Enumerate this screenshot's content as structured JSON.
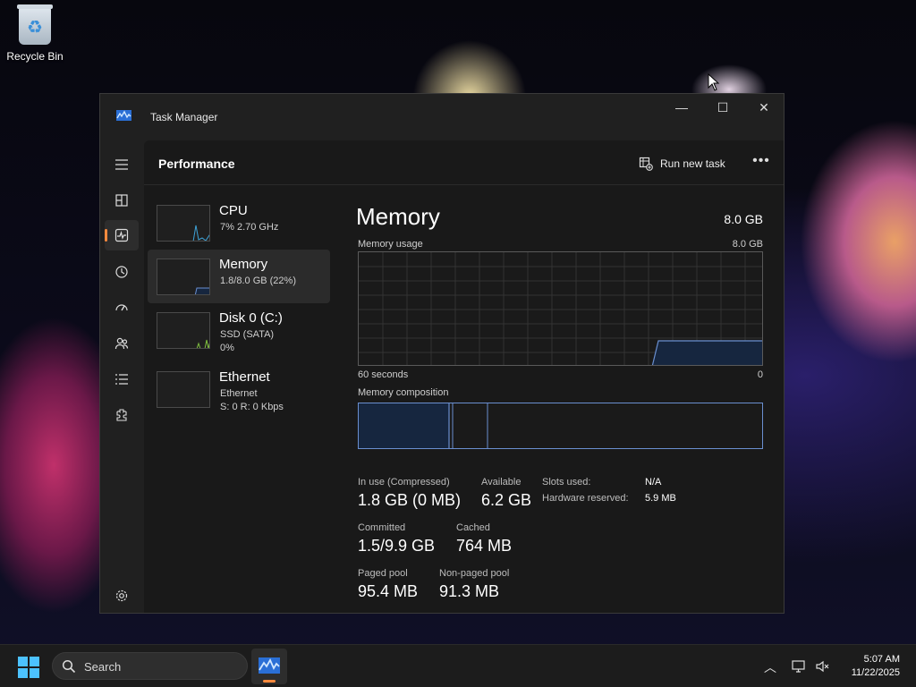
{
  "desktop": {
    "recycle_bin_label": "Recycle Bin"
  },
  "window": {
    "title": "Task Manager",
    "minimize": "—",
    "maximize": "☐",
    "close": "✕"
  },
  "nav": {
    "icons": [
      "hamburger-menu-icon",
      "processes-icon",
      "performance-icon",
      "app-history-icon",
      "startup-apps-icon",
      "users-icon",
      "details-icon",
      "services-icon",
      "settings-icon"
    ],
    "active": "performance-icon"
  },
  "header": {
    "page_title": "Performance",
    "run_new_task": "Run new task",
    "more": "•••"
  },
  "perf_items": [
    {
      "name": "CPU",
      "sub1": "7% 2.70 GHz",
      "sub2": "",
      "sub3": ""
    },
    {
      "name": "Memory",
      "sub1": "1.8/8.0 GB (22%)",
      "sub2": "",
      "sub3": ""
    },
    {
      "name": "Disk 0 (C:)",
      "sub1": "SSD (SATA)",
      "sub2": "0%",
      "sub3": ""
    },
    {
      "name": "Ethernet",
      "sub1": "Ethernet",
      "sub2": "S: 0 R: 0 Kbps",
      "sub3": ""
    }
  ],
  "detail": {
    "title": "Memory",
    "capacity": "8.0 GB",
    "usage_label": "Memory usage",
    "usage_max": "8.0 GB",
    "time_label": "60 seconds",
    "zero_label": "0",
    "composition_label": "Memory composition",
    "stats": {
      "in_use_label": "In use (Compressed)",
      "in_use_value": "1.8 GB (0 MB)",
      "available_label": "Available",
      "available_value": "6.2 GB",
      "committed_label": "Committed",
      "committed_value": "1.5/9.9 GB",
      "cached_label": "Cached",
      "cached_value": "764 MB",
      "paged_label": "Paged pool",
      "paged_value": "95.4 MB",
      "nonpaged_label": "Non-paged pool",
      "nonpaged_value": "91.3 MB",
      "slots_label": "Slots used:",
      "slots_value": "N/A",
      "hw_label": "Hardware reserved:",
      "hw_value": "5.9 MB"
    }
  },
  "colors": {
    "accent_orange": "#ff8a3d",
    "memory_blue": "#6a8fd0",
    "cpu_line": "#3ea3d8",
    "disk_line": "#7fbf3f"
  },
  "taskbar": {
    "search_placeholder": "Search",
    "time": "5:07 AM",
    "date": "11/22/2025"
  }
}
